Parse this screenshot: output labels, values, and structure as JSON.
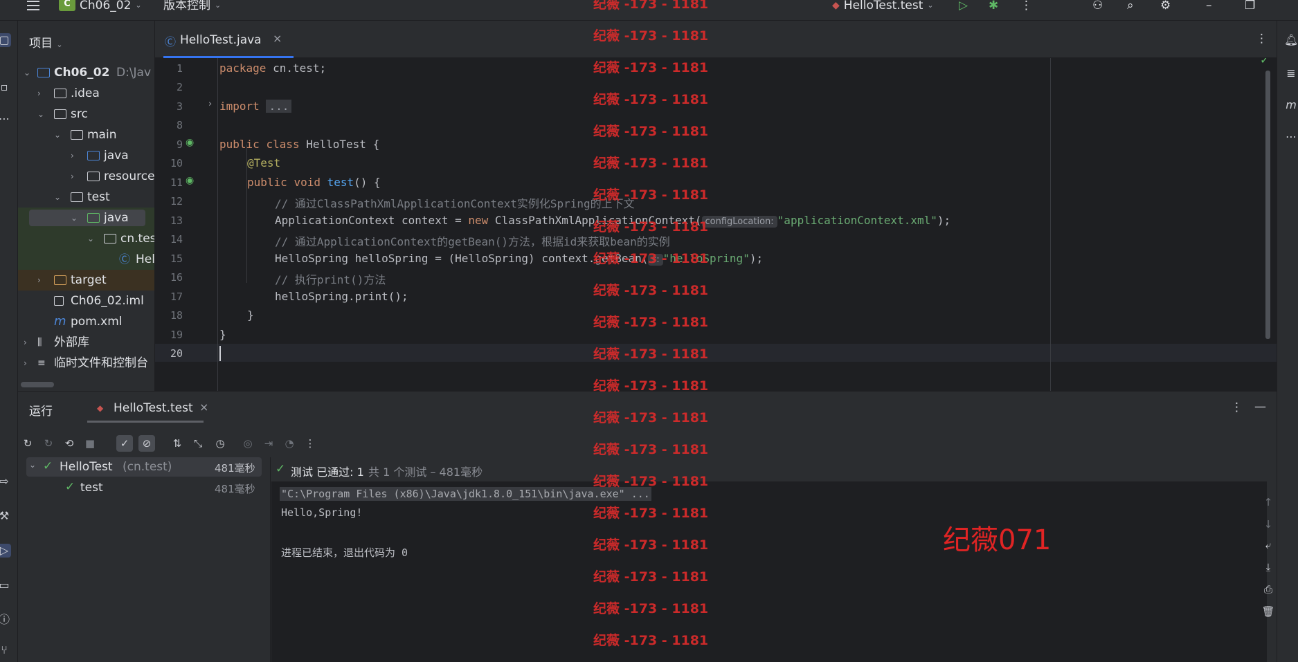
{
  "titlebar": {
    "project_badge": "C",
    "project_name": "Ch06_02",
    "vcs_label": "版本控制",
    "run_config": "HelloTest.test"
  },
  "project_panel": {
    "header": "项目",
    "tree": [
      {
        "label": "Ch06_02",
        "suffix": "D:\\Jav",
        "bold": true
      },
      {
        "label": ".idea"
      },
      {
        "label": "src"
      },
      {
        "label": "main"
      },
      {
        "label": "java"
      },
      {
        "label": "resource"
      },
      {
        "label": "test"
      },
      {
        "label": "java"
      },
      {
        "label": "cn.tes"
      },
      {
        "label": "Hel"
      },
      {
        "label": "target"
      },
      {
        "label": "Ch06_02.iml"
      },
      {
        "label": "pom.xml"
      },
      {
        "label": "外部库"
      },
      {
        "label": "临时文件和控制台"
      }
    ]
  },
  "editor": {
    "tab_label": "HelloTest.java",
    "line_numbers": [
      "1",
      "2",
      "3",
      "8",
      "9",
      "10",
      "11",
      "12",
      "13",
      "14",
      "15",
      "16",
      "17",
      "18",
      "19",
      "20"
    ],
    "lines": {
      "l1_kw": "package",
      "l1_rest": " cn.test;",
      "l3_kw": "import",
      "l3_fold": "...",
      "l9_kw1": "public",
      "l9_kw2": "class",
      "l9_rest": " HelloTest {",
      "l10_ann": "@Test",
      "l11_kw1": "public",
      "l11_kw2": "void",
      "l11_fn": "test",
      "l11_rest": "() {",
      "l12_cmt": "// 通过ClassPathXmlApplicationContext实例化Spring的上下文",
      "l13_a": "ApplicationContext context = ",
      "l13_kw": "new",
      "l13_b": " ClassPathXmlApplicationContext(",
      "l13_hint": "configLocation:",
      "l13_str": "\"applicationContext.xml\"",
      "l13_end": ");",
      "l14_cmt": "// 通过ApplicationContext的getBean()方法，根据id来获取bean的实例",
      "l15_a": "HelloSpring helloSpring = (HelloSpring) context.getBean(",
      "l15_hint": "s:",
      "l15_str": "\"helloSpring\"",
      "l15_end": ");",
      "l16_cmt": "// 执行print()方法",
      "l17": "helloSpring.print();",
      "l18": "}",
      "l19": "}"
    }
  },
  "run_panel": {
    "title": "运行",
    "tab_label": "HelloTest.test",
    "test_tree": [
      {
        "name": "HelloTest",
        "pkg": "(cn.test)",
        "time": "481毫秒"
      },
      {
        "name": "test",
        "pkg": "",
        "time": "481毫秒"
      }
    ],
    "status_check": "测试 已通过: 1",
    "status_rest": "共 1 个测试 – 481毫秒",
    "console_lines": [
      "\"C:\\Program Files (x86)\\Java\\jdk1.8.0_151\\bin\\java.exe\" ...",
      "Hello,Spring!",
      "",
      "进程已结束，退出代码为 0"
    ]
  },
  "watermarks": {
    "repeat": "纪薇 -173 - 1181",
    "big": "纪薇071"
  },
  "colors": {
    "accent": "#3574f0",
    "success": "#5fb865",
    "watermark": "#d62b2b"
  }
}
